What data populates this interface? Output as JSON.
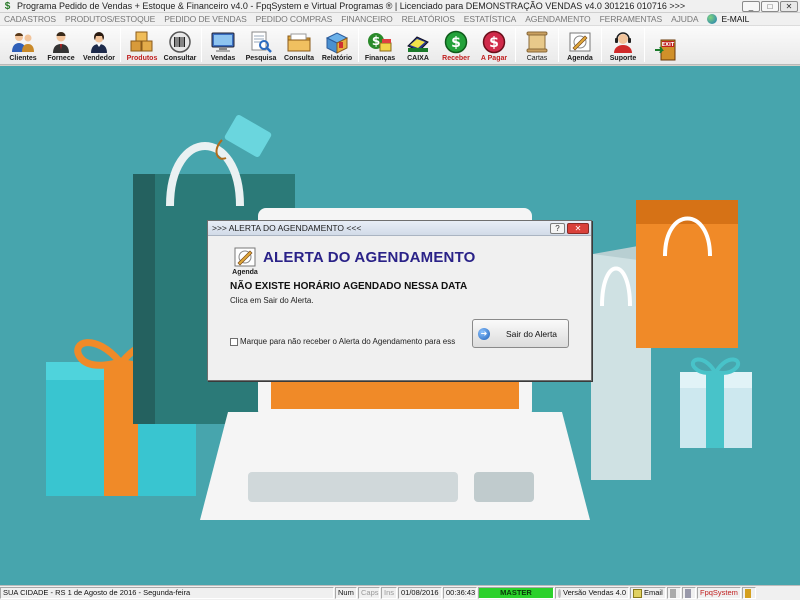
{
  "window": {
    "title": "Programa Pedido de Vendas + Estoque & Financeiro v4.0 - FpqSystem e Virtual Programas ® | Licenciado para  DEMONSTRAÇÃO VENDAS v4.0 301216 010716 >>>",
    "minimize": "_",
    "restore": "□",
    "close": "✕"
  },
  "menu": {
    "items": [
      "CADASTROS",
      "PRODUTOS/ESTOQUE",
      "PEDIDO DE VENDAS",
      "PEDIDO COMPRAS",
      "FINANCEIRO",
      "RELATÓRIOS",
      "ESTATÍSTICA",
      "AGENDAMENTO",
      "FERRAMENTAS",
      "AJUDA"
    ],
    "email": "E-MAIL"
  },
  "toolbar": {
    "clientes": "Clientes",
    "fornece": "Fornece",
    "vendedor": "Vendedor",
    "produtos": "Produtos",
    "consultar": "Consultar",
    "vendas": "Vendas",
    "pesquisa": "Pesquisa",
    "consulta": "Consulta",
    "relatorio": "Relatório",
    "financas": "Finanças",
    "caixa": "CAIXA",
    "receber": "Receber",
    "apagar": "A Pagar",
    "cartas": "Cartas",
    "agenda": "Agenda",
    "suporte": "Suporte",
    "exit": "EXIT"
  },
  "dialog": {
    "title": ">>> ALERTA DO AGENDAMENTO <<<",
    "help": "?",
    "close": "✕",
    "icon_label": "Agenda",
    "heading": "ALERTA DO AGENDAMENTO",
    "message": "NÃO EXISTE HORÁRIO AGENDADO NESSA DATA",
    "hint": "Clica em Sair do Alerta.",
    "checkbox_label": "Marque para não receber o Alerta do Agendamento para ess",
    "checkbox_checked": false,
    "exit_button": "Sair do Alerta"
  },
  "status": {
    "location": "SUA CIDADE - RS   1 de Agosto de 2016 - Segunda-feira",
    "num": "Num",
    "caps": "Caps",
    "ins": "Ins",
    "date": "01/08/2016",
    "time": "00:36:43",
    "user": "MASTER",
    "version": "Versão Vendas 4.0",
    "email": "Email",
    "brand": "FpqSystem"
  },
  "colors": {
    "background": "#47a5ad",
    "heading": "#2a2288",
    "master": "#2bd12b"
  }
}
